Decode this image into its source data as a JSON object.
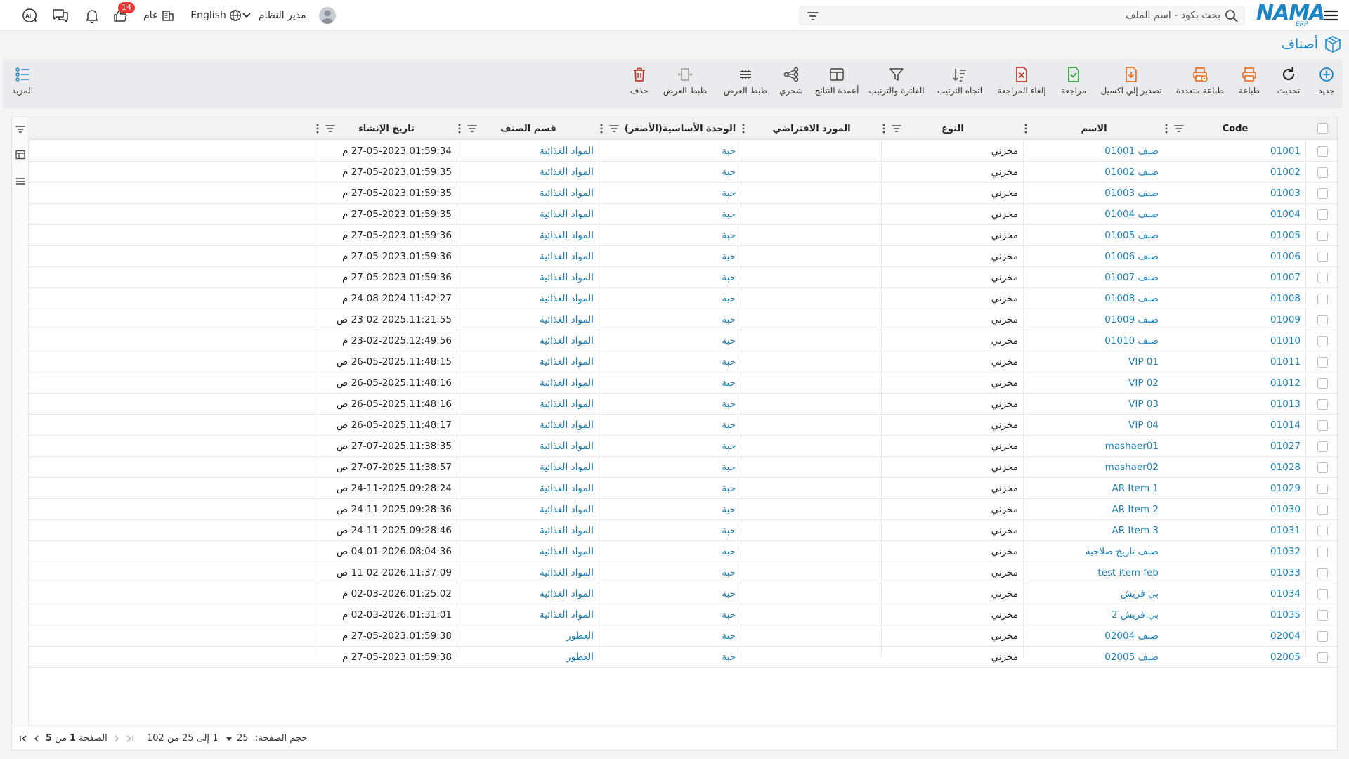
{
  "topbar": {
    "logo": "NAMA",
    "logo_sub": "ERP",
    "search_placeholder": "بحث بكود - اسم الملف",
    "user_name": "مدير النظام",
    "language": "English",
    "public_label": "عام",
    "likes_badge": "14"
  },
  "page": {
    "title": "أصناف"
  },
  "toolbar": {
    "new": "جديد",
    "refresh": "تحديث",
    "print": "طباعة",
    "multi_print": "طباعة متعددة",
    "export_excel": "تصدير إلي اكسيل",
    "review": "مراجعة",
    "cancel_review": "إلغاء المراجعة",
    "sort_direction": "اتجاه الترتيب",
    "filter_sort": "الفلترة والترتيب",
    "result_columns": "أعمدة النتائج",
    "tree": "شجري",
    "display_settings_1": "ظبط العرض",
    "display_settings_2": "ظبط العرض",
    "delete": "حذف",
    "more": "المزيد"
  },
  "columns": {
    "code": "Code",
    "name": "الاسم",
    "type": "النوع",
    "supplier": "المورد الافتراضي",
    "unit": "الوحدة الأساسية(الأصغر)",
    "category": "قسم الصنف",
    "created": "تاريخ الإنشاء"
  },
  "rows": [
    {
      "code": "01001",
      "name": "صنف 01001",
      "type": "مخزني",
      "supplier": "",
      "unit": "حبة",
      "category": "المواد الغذائية",
      "created": "27-05-2023.01:59:34 م"
    },
    {
      "code": "01002",
      "name": "صنف 01002",
      "type": "مخزني",
      "supplier": "",
      "unit": "حبة",
      "category": "المواد الغذائية",
      "created": "27-05-2023.01:59:35 م"
    },
    {
      "code": "01003",
      "name": "صنف 01003",
      "type": "مخزني",
      "supplier": "",
      "unit": "حبة",
      "category": "المواد الغذائية",
      "created": "27-05-2023.01:59:35 م"
    },
    {
      "code": "01004",
      "name": "صنف 01004",
      "type": "مخزني",
      "supplier": "",
      "unit": "حبة",
      "category": "المواد الغذائية",
      "created": "27-05-2023.01:59:35 م"
    },
    {
      "code": "01005",
      "name": "صنف 01005",
      "type": "مخزني",
      "supplier": "",
      "unit": "حبة",
      "category": "المواد الغذائية",
      "created": "27-05-2023.01:59:36 م"
    },
    {
      "code": "01006",
      "name": "صنف 01006",
      "type": "مخزني",
      "supplier": "",
      "unit": "حبة",
      "category": "المواد الغذائية",
      "created": "27-05-2023.01:59:36 م"
    },
    {
      "code": "01007",
      "name": "صنف 01007",
      "type": "مخزني",
      "supplier": "",
      "unit": "حبة",
      "category": "المواد الغذائية",
      "created": "27-05-2023.01:59:36 م"
    },
    {
      "code": "01008",
      "name": "صنف 01008",
      "type": "مخزني",
      "supplier": "",
      "unit": "حبة",
      "category": "المواد الغذائية",
      "created": "24-08-2024.11:42:27 م"
    },
    {
      "code": "01009",
      "name": "صنف 01009",
      "type": "مخزني",
      "supplier": "",
      "unit": "حبة",
      "category": "المواد الغذائية",
      "created": "23-02-2025.11:21:55 ص"
    },
    {
      "code": "01010",
      "name": "صنف 01010",
      "type": "مخزني",
      "supplier": "",
      "unit": "حبة",
      "category": "المواد الغذائية",
      "created": "23-02-2025.12:49:56 م"
    },
    {
      "code": "01011",
      "name": "VIP 01",
      "type": "مخزني",
      "supplier": "",
      "unit": "حبة",
      "category": "المواد الغذائية",
      "created": "26-05-2025.11:48:15 ص"
    },
    {
      "code": "01012",
      "name": "VIP 02",
      "type": "مخزني",
      "supplier": "",
      "unit": "حبة",
      "category": "المواد الغذائية",
      "created": "26-05-2025.11:48:16 ص"
    },
    {
      "code": "01013",
      "name": "VIP 03",
      "type": "مخزني",
      "supplier": "",
      "unit": "حبة",
      "category": "المواد الغذائية",
      "created": "26-05-2025.11:48:16 ص"
    },
    {
      "code": "01014",
      "name": "VIP 04",
      "type": "مخزني",
      "supplier": "",
      "unit": "حبة",
      "category": "المواد الغذائية",
      "created": "26-05-2025.11:48:17 ص"
    },
    {
      "code": "01027",
      "name": "mashaer01",
      "type": "مخزني",
      "supplier": "",
      "unit": "حبة",
      "category": "المواد الغذائية",
      "created": "27-07-2025.11:38:35 ص"
    },
    {
      "code": "01028",
      "name": "mashaer02",
      "type": "مخزني",
      "supplier": "",
      "unit": "حبة",
      "category": "المواد الغذائية",
      "created": "27-07-2025.11:38:57 ص"
    },
    {
      "code": "01029",
      "name": "AR Item 1",
      "type": "مخزني",
      "supplier": "",
      "unit": "حبة",
      "category": "المواد الغذائية",
      "created": "24-11-2025.09:28:24 ص"
    },
    {
      "code": "01030",
      "name": "AR Item 2",
      "type": "مخزني",
      "supplier": "",
      "unit": "حبة",
      "category": "المواد الغذائية",
      "created": "24-11-2025.09:28:36 ص"
    },
    {
      "code": "01031",
      "name": "AR Item 3",
      "type": "مخزني",
      "supplier": "",
      "unit": "حبة",
      "category": "المواد الغذائية",
      "created": "24-11-2025.09:28:46 ص"
    },
    {
      "code": "01032",
      "name": "صنف تاريخ صلاحية",
      "type": "مخزني",
      "supplier": "",
      "unit": "حبة",
      "category": "المواد الغذائية",
      "created": "04-01-2026.08:04:36 ص"
    },
    {
      "code": "01033",
      "name": "test item feb",
      "type": "مخزني",
      "supplier": "",
      "unit": "حبة",
      "category": "المواد الغذائية",
      "created": "11-02-2026.11:37:09 ص"
    },
    {
      "code": "01034",
      "name": "بي فريش",
      "type": "مخزني",
      "supplier": "",
      "unit": "حبة",
      "category": "المواد الغذائية",
      "created": "02-03-2026.01:25:02 م"
    },
    {
      "code": "01035",
      "name": "بي فريش 2",
      "type": "مخزني",
      "supplier": "",
      "unit": "حبة",
      "category": "المواد الغذائية",
      "created": "02-03-2026.01:31:01 م"
    },
    {
      "code": "02004",
      "name": "صنف 02004",
      "type": "مخزني",
      "supplier": "",
      "unit": "حبة",
      "category": "العطور",
      "created": "27-05-2023.01:59:38 م"
    },
    {
      "code": "02005",
      "name": "صنف 02005",
      "type": "مخزني",
      "supplier": "",
      "unit": "حبة",
      "category": "العطور",
      "created": "27-05-2023.01:59:38 م"
    }
  ],
  "footer": {
    "page_size_label": "حجم الصفحة:",
    "page_size": "25",
    "range": "1 إلى 25 من 102",
    "page_label": "الصفحة",
    "page_num": "1",
    "of_label": "من",
    "total_pages": "5"
  },
  "colors": {
    "accent": "#1a86c8",
    "link": "#1a7fb8",
    "orange": "#e8732a",
    "green": "#3c9a3c",
    "red": "#c0392b"
  }
}
